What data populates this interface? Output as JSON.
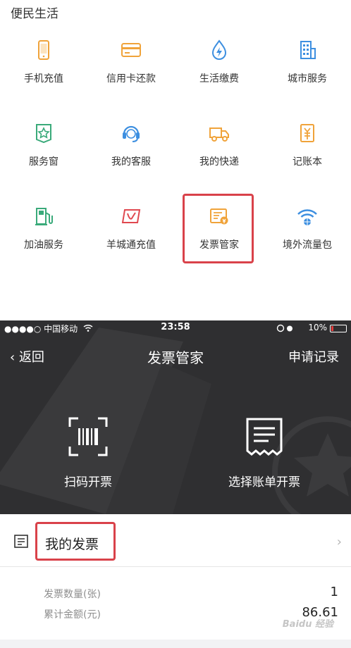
{
  "section": {
    "title": "便民生活"
  },
  "services": [
    {
      "label": "手机充值",
      "icon": "phone-icon",
      "color": "#f0a33a"
    },
    {
      "label": "信用卡还款",
      "icon": "credit-card-icon",
      "color": "#f0a33a"
    },
    {
      "label": "生活缴费",
      "icon": "water-drop-bolt-icon",
      "color": "#3d8fe0"
    },
    {
      "label": "城市服务",
      "icon": "building-icon",
      "color": "#3d8fe0"
    },
    {
      "label": "服务窗",
      "icon": "star-window-icon",
      "color": "#3aaa7a"
    },
    {
      "label": "我的客服",
      "icon": "headset-icon",
      "color": "#3d8fe0"
    },
    {
      "label": "我的快递",
      "icon": "truck-icon",
      "color": "#f0a33a"
    },
    {
      "label": "记账本",
      "icon": "yuan-ledger-icon",
      "color": "#f0a33a"
    },
    {
      "label": "加油服务",
      "icon": "gas-station-icon",
      "color": "#3aaa7a"
    },
    {
      "label": "羊城通充值",
      "icon": "yct-card-icon",
      "color": "#e0484f"
    },
    {
      "label": "发票管家",
      "icon": "invoice-icon",
      "color": "#f0a33a"
    },
    {
      "label": "境外流量包",
      "icon": "wifi-globe-icon",
      "color": "#3d8fe0"
    }
  ],
  "status_bar": {
    "carrier": "●●●●○ 中国移动",
    "time": "23:58",
    "battery": "10%"
  },
  "nav": {
    "back": "返回",
    "title": "发票管家",
    "right": "申请记录"
  },
  "actions": [
    {
      "label": "扫码开票",
      "icon": "scan-barcode-icon"
    },
    {
      "label": "选择账单开票",
      "icon": "bill-receipt-icon"
    }
  ],
  "my_invoice": {
    "title": "我的发票",
    "icon": "invoice-list-icon"
  },
  "stats": [
    {
      "label": "发票数量(张)",
      "value": "1"
    },
    {
      "label": "累计金额(元)",
      "value": "86.61"
    }
  ],
  "watermark": "Baidu 经验",
  "colors": {
    "highlight": "#d9424a",
    "dark_bg": "#2f2f31"
  }
}
